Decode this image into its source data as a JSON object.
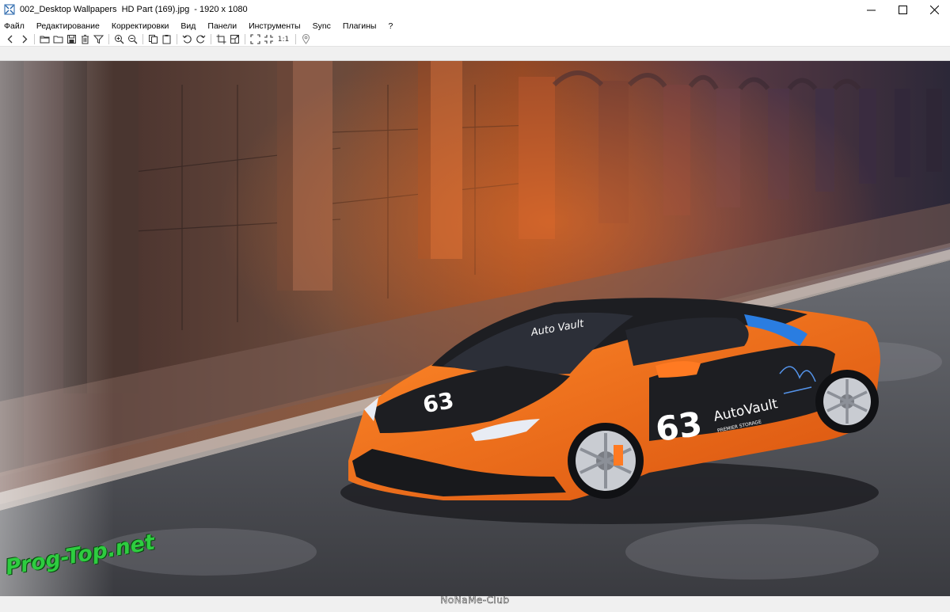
{
  "window": {
    "title": "002_Desktop Wallpapers  HD Part (169).jpg  - 1920 x 1080",
    "app_icon": "viewer-app-icon",
    "controls": [
      "minimize-icon",
      "maximize-icon",
      "close-icon"
    ]
  },
  "menu": {
    "items": [
      "Файл",
      "Редактирование",
      "Корректировки",
      "Вид",
      "Панели",
      "Инструменты",
      "Sync",
      "Плагины",
      "?"
    ]
  },
  "toolbar": {
    "icons": [
      "back-arrow-icon",
      "forward-arrow-icon",
      "open-file-icon",
      "open-folder-icon",
      "save-icon",
      "delete-icon",
      "filter-icon",
      "zoom-in-icon",
      "zoom-out-icon",
      "copy-icon",
      "paste-icon",
      "rotate-left-icon",
      "rotate-right-icon",
      "crop-icon",
      "resize-icon",
      "fullscreen-icon",
      "fit-icon",
      "actual-size-icon",
      "location-pin-icon"
    ],
    "actual_size_label": "1:1"
  },
  "image": {
    "description_colors": {
      "orange": "#f26b1d",
      "body_dark": "#1d1e22",
      "accent_blue": "#2a7de1"
    },
    "car_text": {
      "hood_number": "63",
      "side_number": "63",
      "windshield": "Auto Vault",
      "door_brand": "AutoVault",
      "door_sub": "PREMIER STORAGE"
    }
  },
  "watermarks": {
    "left": "Prog-Top.net",
    "bottom": "NoNaMe-Club"
  }
}
